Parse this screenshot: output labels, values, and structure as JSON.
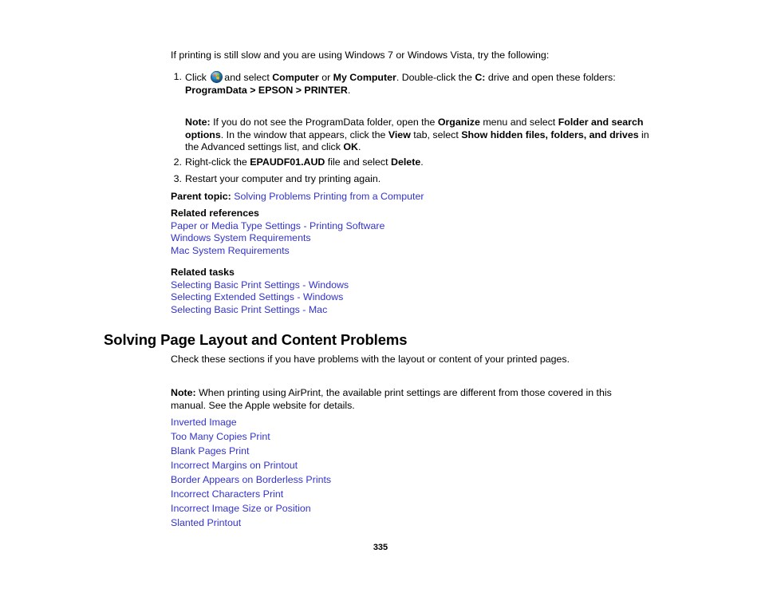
{
  "document": {
    "page_number": "335",
    "link_color": "#3333cc",
    "text_color": "#000000",
    "background_color": "#ffffff"
  },
  "intro": {
    "text": "If printing is still slow and you are using Windows 7 or Windows Vista, try the following:"
  },
  "steps": [
    {
      "number": "1.",
      "parts": [
        {
          "type": "text",
          "value": "Click "
        },
        {
          "type": "icon",
          "value": "windows-start-orb-icon"
        },
        {
          "type": "text",
          "value": "and select "
        },
        {
          "type": "bold",
          "value": "Computer"
        },
        {
          "type": "text",
          "value": " or "
        },
        {
          "type": "bold",
          "value": "My Computer"
        },
        {
          "type": "text",
          "value": ". Double-click the "
        },
        {
          "type": "bold",
          "value": "C:"
        },
        {
          "type": "text",
          "value": " drive and open these folders: "
        },
        {
          "type": "bold",
          "value": "ProgramData > EPSON > PRINTER"
        },
        {
          "type": "text",
          "value": "."
        }
      ]
    },
    {
      "number": "2.",
      "parts": [
        {
          "type": "text",
          "value": "Right-click the "
        },
        {
          "type": "bold",
          "value": "EPAUDF01.AUD"
        },
        {
          "type": "text",
          "value": " file and select "
        },
        {
          "type": "bold",
          "value": "Delete"
        },
        {
          "type": "text",
          "value": "."
        }
      ]
    },
    {
      "number": "3.",
      "parts": [
        {
          "type": "text",
          "value": "Restart your computer and try printing again."
        }
      ]
    }
  ],
  "step_note": {
    "label": "Note:",
    "parts": [
      {
        "type": "text",
        "value": " If you do not see the ProgramData folder, open the "
      },
      {
        "type": "bold",
        "value": "Organize"
      },
      {
        "type": "text",
        "value": " menu and select "
      },
      {
        "type": "bold",
        "value": "Folder and search options"
      },
      {
        "type": "text",
        "value": ". In the window that appears, click the "
      },
      {
        "type": "bold",
        "value": "View"
      },
      {
        "type": "text",
        "value": " tab, select "
      },
      {
        "type": "bold",
        "value": "Show hidden files, folders, and drives"
      },
      {
        "type": "text",
        "value": " in the Advanced settings list, and click "
      },
      {
        "type": "bold",
        "value": "OK"
      },
      {
        "type": "text",
        "value": "."
      }
    ]
  },
  "parent_topic": {
    "label": "Parent topic:",
    "link": "Solving Problems Printing from a Computer"
  },
  "related_references": {
    "heading": "Related references",
    "links": [
      "Paper or Media Type Settings - Printing Software",
      "Windows System Requirements",
      "Mac System Requirements"
    ]
  },
  "related_tasks": {
    "heading": "Related tasks",
    "links": [
      "Selecting Basic Print Settings - Windows",
      "Selecting Extended Settings - Windows",
      "Selecting Basic Print Settings - Mac"
    ]
  },
  "section": {
    "heading": "Solving Page Layout and Content Problems",
    "intro": "Check these sections if you have problems with the layout or content of your printed pages.",
    "note": {
      "label": "Note:",
      "text": " When printing using AirPrint, the available print settings are different from those covered in this manual. See the Apple website for details."
    },
    "topic_links": [
      "Inverted Image",
      "Too Many Copies Print",
      "Blank Pages Print",
      "Incorrect Margins on Printout",
      "Border Appears on Borderless Prints",
      "Incorrect Characters Print",
      "Incorrect Image Size or Position",
      "Slanted Printout"
    ]
  }
}
